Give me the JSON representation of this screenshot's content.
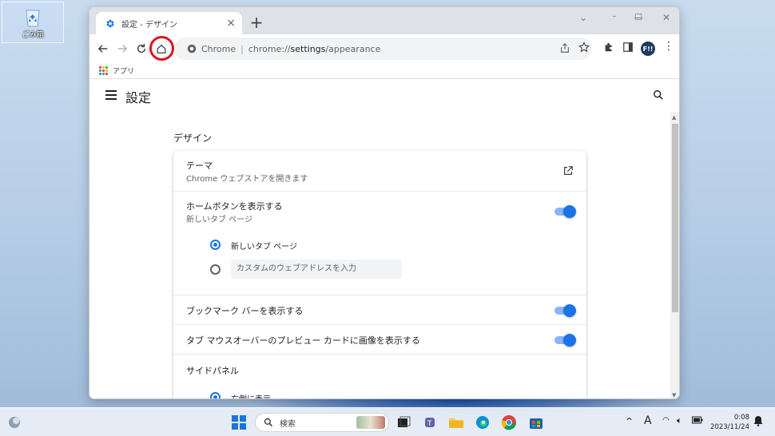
{
  "desktop": {
    "recycle_bin_label": "ごみ箱"
  },
  "browser": {
    "tab_title": "設定 - デザイン",
    "new_tab": "+",
    "address": {
      "site_label": "Chrome",
      "url_prefix": "chrome://",
      "url_bold": "settings",
      "url_suffix": "/appearance"
    },
    "avatar_initials": "F!!",
    "bookmarks_apps_label": "アプリ"
  },
  "settings": {
    "title": "設定",
    "section_title": "デザイン",
    "theme": {
      "label": "テーマ",
      "sub": "Chrome ウェブストアを開きます"
    },
    "home_button": {
      "label": "ホームボタンを表示する",
      "sub": "新しいタブ ページ",
      "enabled": true,
      "options": [
        {
          "label": "新しいタブ ページ",
          "selected": true
        },
        {
          "label": "",
          "selected": false
        }
      ],
      "custom_placeholder": "カスタムのウェブアドレスを入力"
    },
    "bookmark_bar": {
      "label": "ブックマーク バーを表示する",
      "enabled": true
    },
    "tab_preview": {
      "label": "タブ マウスオーバーのプレビュー カードに画像を表示する",
      "enabled": true
    },
    "side_panel": {
      "label": "サイドパネル",
      "option_right": "右側に表示"
    }
  },
  "taskbar": {
    "search_label": "検索",
    "ime": "A",
    "time": "0:08",
    "date": "2023/11/24"
  },
  "colors": {
    "accent": "#1a73e8",
    "highlight_ring": "#e0151d"
  }
}
